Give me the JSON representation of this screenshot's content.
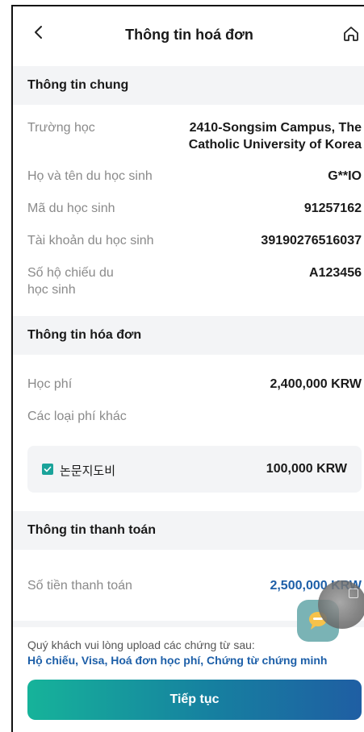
{
  "header": {
    "title": "Thông tin hoá đơn"
  },
  "general": {
    "title": "Thông tin chung",
    "school_label": "Trường học",
    "school_value_line1": "2410-Songsim Campus, The",
    "school_value_line2": "Catholic University of Korea",
    "name_label": "Họ và tên du học sinh",
    "name_value": "G**IO",
    "student_id_label": "Mã du học sinh",
    "student_id_value": "91257162",
    "account_label": "Tài khoản du học sinh",
    "account_value": "39190276516037",
    "passport_label_line1": "Số hộ chiếu du",
    "passport_label_line2": "học sinh",
    "passport_value": "A123456"
  },
  "invoice": {
    "title": "Thông tin hóa đơn",
    "tuition_label": "Học phí",
    "tuition_value": "2,400,000 KRW",
    "other_fees_label": "Các loại phí khác",
    "other_fee_item_label": "논문지도비",
    "other_fee_item_value": "100,000 KRW",
    "other_fee_item_checked": true
  },
  "payment": {
    "title": "Thông tin thanh toán",
    "amount_label": "Số tiền thanh toán",
    "amount_value": "2,500,000 KRW"
  },
  "notice": {
    "text": "Quý khách vui lòng upload các chứng từ sau:",
    "documents": "Hộ chiếu, Visa, Hoá đơn học phí, Chứng từ chứng minh"
  },
  "cta": {
    "label": "Tiếp tục"
  },
  "colors": {
    "accent": "#1d5fa8",
    "teal": "#1aa39a",
    "section_bg": "#f3f4f6"
  },
  "icons": {
    "back": "chevron-left-icon",
    "home": "home-icon",
    "chat": "chat-icon"
  }
}
